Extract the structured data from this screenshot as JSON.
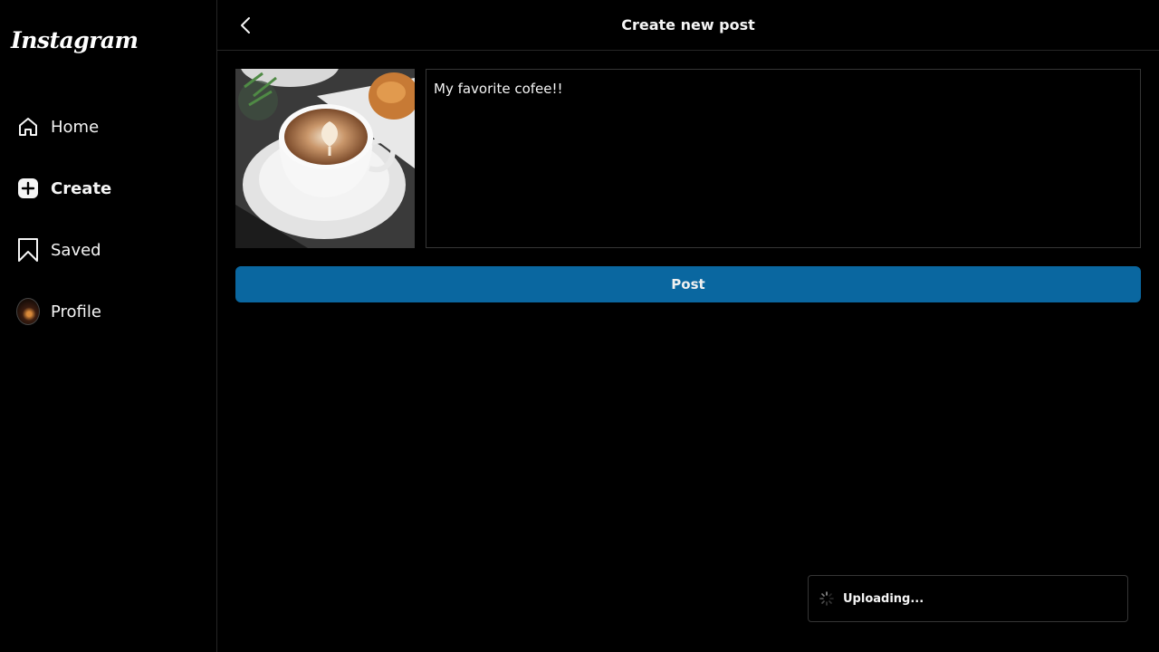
{
  "sidebar": {
    "logo": "Instagram",
    "items": [
      {
        "label": "Home",
        "icon": "home-icon"
      },
      {
        "label": "Create",
        "icon": "plus-square-icon",
        "active": true
      },
      {
        "label": "Saved",
        "icon": "bookmark-icon"
      },
      {
        "label": "Profile",
        "icon": "avatar"
      }
    ]
  },
  "header": {
    "title": "Create new post"
  },
  "composer": {
    "caption": "My favorite cofee!!",
    "image_alt": "latte in white cup with pastry",
    "post_label": "Post"
  },
  "toast": {
    "text": "Uploading..."
  },
  "colors": {
    "background": "#000000",
    "post_button": "#0a67a0",
    "border": "#363636"
  }
}
